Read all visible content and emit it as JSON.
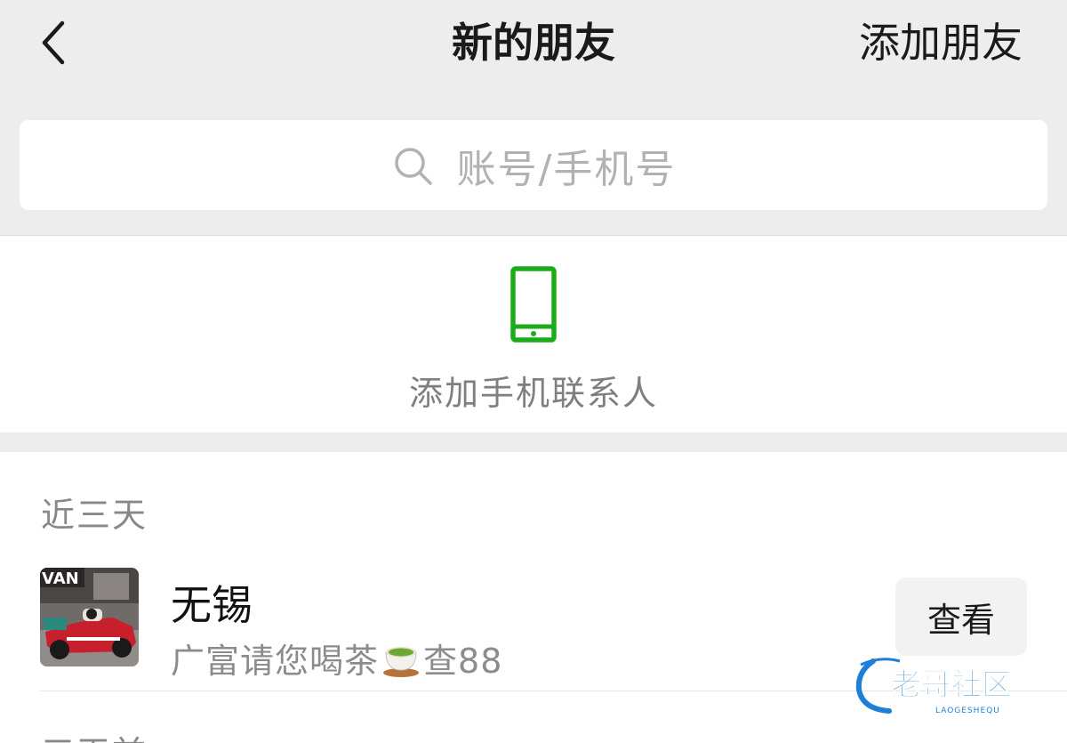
{
  "navbar": {
    "back_icon": "chevron-left-icon",
    "title": "新的朋友",
    "action_label": "添加朋友"
  },
  "search": {
    "icon": "search-icon",
    "placeholder": "账号/手机号"
  },
  "phone_contacts": {
    "icon": "mobile-phone-icon",
    "label": "添加手机联系人",
    "accent_color": "#1aad19"
  },
  "recent": {
    "section_label": "近三天",
    "items": [
      {
        "name": "无锡",
        "message_before": "广富请您喝茶",
        "message_emoji": "tea-cup-icon",
        "message_after": "查88",
        "action_label": "查看"
      }
    ]
  },
  "earlier": {
    "section_label": "三天前"
  },
  "watermark": {
    "title": "老哥社区",
    "subtitle": "LAOGESHEQU"
  }
}
